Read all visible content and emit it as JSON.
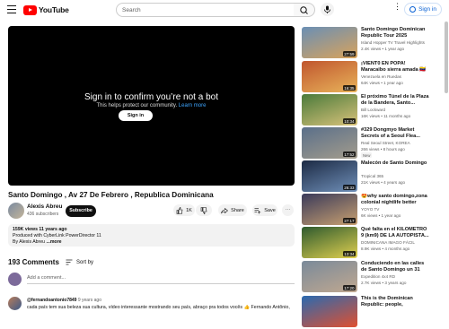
{
  "header": {
    "logo_text": "YouTube",
    "search_placeholder": "Search",
    "signin_label": "Sign in",
    "more_icon": "⋮"
  },
  "player": {
    "prompt_title": "Sign in to confirm you’re not a bot",
    "prompt_text": "This helps protect our community.",
    "prompt_link": "Learn more",
    "signin_button": "Sign in"
  },
  "video": {
    "title": "Santo Domingo , Av 27 De Febrero , Republica Dominicana",
    "channel": "Alexis Abreu",
    "subscribers": "436 subscribers",
    "subscribe_label": "Subscribe",
    "likes": "1K",
    "share_label": "Share",
    "save_label": "Save",
    "more_label": "⋯"
  },
  "description": {
    "views_date": "159K views  11 years ago",
    "line2": "Produced with CyberLink PowerDirector 11",
    "line3": "By Alexis Abreu",
    "more": "...more"
  },
  "comments": {
    "count": "193 Comments",
    "sort_label": "Sort by",
    "add_placeholder": "Add a comment...",
    "first": {
      "author": "@fernandoantonio7849",
      "age": "9 years ago",
      "text": "cada país tem sua beleza sua cultura, vídeo interessante mostrando seu país, abraço pra todos vocês 👍 Fernando Antônio,"
    }
  },
  "recommendations": [
    {
      "title": "Santo Domingo Dominican Republic Tour 2025",
      "channel": "Island Hopper TV Travel Highlights",
      "meta": "2.4K views • 1 year ago",
      "duration": "27:59",
      "new": "",
      "c1": "#6a8fb5",
      "c2": "#d9a35b"
    },
    {
      "title": "¡VIENT0 EN POPA! Maracaibo sierra amada 🇻🇪 Venezuela e...",
      "channel": "Venezuela en Ruedas",
      "meta": "64K views • 1 year ago",
      "duration": "16:35",
      "new": "",
      "c1": "#c0562e",
      "c2": "#e8b35a"
    },
    {
      "title": "El próximo Túnel de la Plaza de la Bandera, Santo...",
      "channel": "Bill Lockward",
      "meta": "16K views • 11 months ago",
      "duration": "10:34",
      "new": "",
      "c1": "#4a7a3a",
      "c2": "#d8c27a"
    },
    {
      "title": "#329 Dongmyo Market Secrets of a Seoul Flea...",
      "channel": "Real Seoul Street, KOREA",
      "meta": "266 views • 8 hours ago",
      "duration": "17:52",
      "new": "New",
      "c1": "#5a6f8a",
      "c2": "#a39c8c"
    },
    {
      "title": "Malecón de Santo Domingo",
      "channel": "Tropical 365",
      "meta": "21K views • 4 years ago",
      "duration": "26:33",
      "new": "",
      "c1": "#1c2a44",
      "c2": "#6f8fb8"
    },
    {
      "title": "😍why santo domingo,zona colonial nightlife better than...",
      "channel": "YOYO TV",
      "meta": "6K views • 1 year ago",
      "duration": "27:17",
      "new": "",
      "c1": "#3a3a5a",
      "c2": "#c8a070"
    },
    {
      "title": "Qué falta en el KILÓMETRO 9 (km9) DE LA AUTOPISTA...",
      "channel": "DOMINICANA IMAGO FÁCIL",
      "meta": "8.9K views • 4 months ago",
      "duration": "13:34",
      "new": "",
      "c1": "#2e5a2e",
      "c2": "#e0d050"
    },
    {
      "title": "Conduciendo en las calles de Santo Domingo un 31 de...",
      "channel": "Expedition 4x4 RD",
      "meta": "2.7K views • 3 years ago",
      "duration": "17:20",
      "new": "",
      "c1": "#7a8a9a",
      "c2": "#c0a890"
    },
    {
      "title": "This is the Dominican Republic: people, customs,...",
      "channel": "",
      "meta": "",
      "duration": "",
      "new": "",
      "c1": "#2a6ab0",
      "c2": "#e05030"
    }
  ],
  "colors": {
    "accent": "#065fd4",
    "brand": "#ff0000"
  }
}
